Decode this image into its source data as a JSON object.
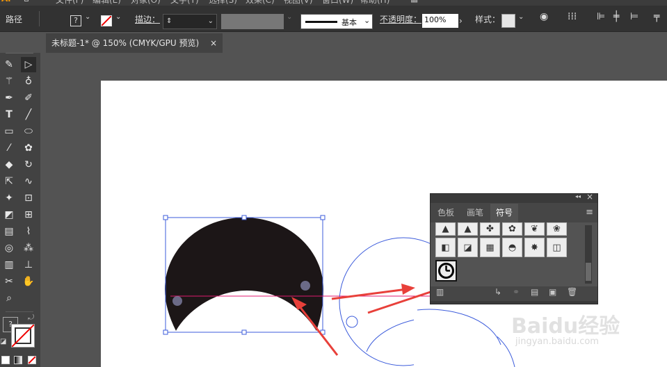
{
  "menubar": {
    "items": [
      "Ai",
      "文件(F)",
      "编辑(E)",
      "对象(O)",
      "文字(T)",
      "选择(S)",
      "效果(C)",
      "视图(V)",
      "窗口(W)",
      "帮助(H)"
    ]
  },
  "control_bar": {
    "path_label": "路径",
    "fill_value": "?",
    "stroke_label": "描边：",
    "stroke_weight": "",
    "brush_label": "基本",
    "opacity_label": "不透明度：",
    "opacity_value": "100%",
    "style_label": "样式："
  },
  "document_tab": {
    "title": "未标题-1* @ 150% (CMYK/GPU 预览)",
    "close": "×"
  },
  "toolbox": {
    "fill_stroke_question": "?"
  },
  "symbols_panel": {
    "tabs": [
      "色板",
      "画笔",
      "符号"
    ],
    "active_tab": "符号",
    "menu_icon": "≡",
    "collapse": "◂◂",
    "close": "×"
  },
  "watermark": {
    "brand": "Baidu经验",
    "url": "jingyan.baidu.com"
  },
  "colors": {
    "accent_line": "#e01a6f",
    "selection": "#3b5bdb",
    "arrow": "#e8403a",
    "shape_fill": "#1c1617"
  }
}
